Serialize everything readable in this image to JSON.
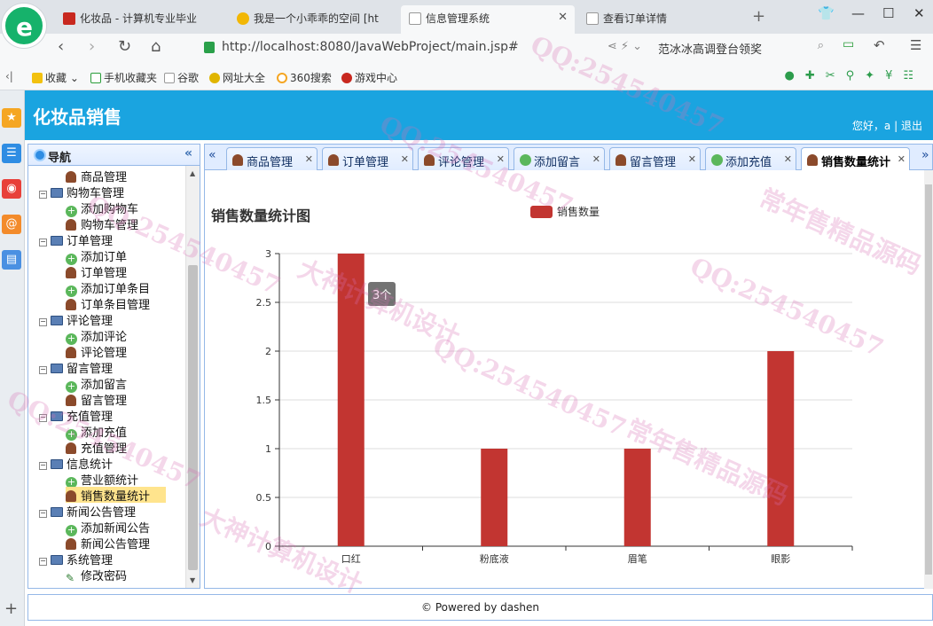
{
  "browser": {
    "tabs": [
      {
        "label": "化妆品 - 计算机专业毕业",
        "active": false
      },
      {
        "label": "我是一个小乖乖的空间 [ht",
        "active": false
      },
      {
        "label": "信息管理系统",
        "active": true
      },
      {
        "label": "查看订单详情",
        "active": false
      }
    ],
    "url": "http://localhost:8080/JavaWebProject/main.jsp#",
    "search_text": "范冰冰高调登台领奖",
    "bookmarks": [
      "收藏",
      "手机收藏夹",
      "谷歌",
      "网址大全",
      "360搜索",
      "游戏中心"
    ]
  },
  "app": {
    "title": "化妆品销售",
    "greeting": "您好，a",
    "separator": "|",
    "logout": "退出",
    "footer": "© Powered by dashen",
    "accent_color": "#1aa4e0"
  },
  "nav": {
    "title": "导航",
    "tree": [
      {
        "level": "child",
        "icon": "user",
        "label": "商品管理"
      },
      {
        "level": "parent",
        "label": "购物车管理"
      },
      {
        "level": "child",
        "icon": "add",
        "label": "添加购物车"
      },
      {
        "level": "child",
        "icon": "user",
        "label": "购物车管理"
      },
      {
        "level": "parent",
        "label": "订单管理"
      },
      {
        "level": "child",
        "icon": "add",
        "label": "添加订单"
      },
      {
        "level": "child",
        "icon": "user",
        "label": "订单管理"
      },
      {
        "level": "child",
        "icon": "add",
        "label": "添加订单条目"
      },
      {
        "level": "child",
        "icon": "user",
        "label": "订单条目管理"
      },
      {
        "level": "parent",
        "label": "评论管理"
      },
      {
        "level": "child",
        "icon": "add",
        "label": "添加评论"
      },
      {
        "level": "child",
        "icon": "user",
        "label": "评论管理"
      },
      {
        "level": "parent",
        "label": "留言管理"
      },
      {
        "level": "child",
        "icon": "add",
        "label": "添加留言"
      },
      {
        "level": "child",
        "icon": "user",
        "label": "留言管理"
      },
      {
        "level": "parent",
        "label": "充值管理"
      },
      {
        "level": "child",
        "icon": "add",
        "label": "添加充值"
      },
      {
        "level": "child",
        "icon": "user",
        "label": "充值管理"
      },
      {
        "level": "parent",
        "label": "信息统计"
      },
      {
        "level": "child",
        "icon": "add",
        "label": "营业额统计"
      },
      {
        "level": "child",
        "icon": "user",
        "label": "销售数量统计",
        "selected": true
      },
      {
        "level": "parent",
        "label": "新闻公告管理"
      },
      {
        "level": "child",
        "icon": "add",
        "label": "添加新闻公告"
      },
      {
        "level": "child",
        "icon": "user",
        "label": "新闻公告管理"
      },
      {
        "level": "parent",
        "label": "系统管理"
      },
      {
        "level": "child",
        "icon": "pencil",
        "label": "修改密码"
      }
    ]
  },
  "content_tabs": [
    {
      "label": "商品管理",
      "icon": "user"
    },
    {
      "label": "订单管理",
      "icon": "user"
    },
    {
      "label": "评论管理",
      "icon": "user"
    },
    {
      "label": "添加留言",
      "icon": "add"
    },
    {
      "label": "留言管理",
      "icon": "user"
    },
    {
      "label": "添加充值",
      "icon": "add"
    },
    {
      "label": "销售数量统计",
      "icon": "user",
      "active": true
    }
  ],
  "chart_data": {
    "type": "bar",
    "title": "销售数量统计图",
    "categories": [
      "口红",
      "粉底液",
      "眉笔",
      "眼影"
    ],
    "series": [
      {
        "name": "销售数量",
        "values": [
          3,
          1,
          1,
          2
        ],
        "color": "#c23531"
      }
    ],
    "ylim": [
      0,
      3
    ],
    "yticks": [
      "0",
      "0.5",
      "1",
      "1.5",
      "2",
      "2.5",
      "3"
    ],
    "grid": true,
    "legend_position": "top-center",
    "tooltip": "3个"
  }
}
